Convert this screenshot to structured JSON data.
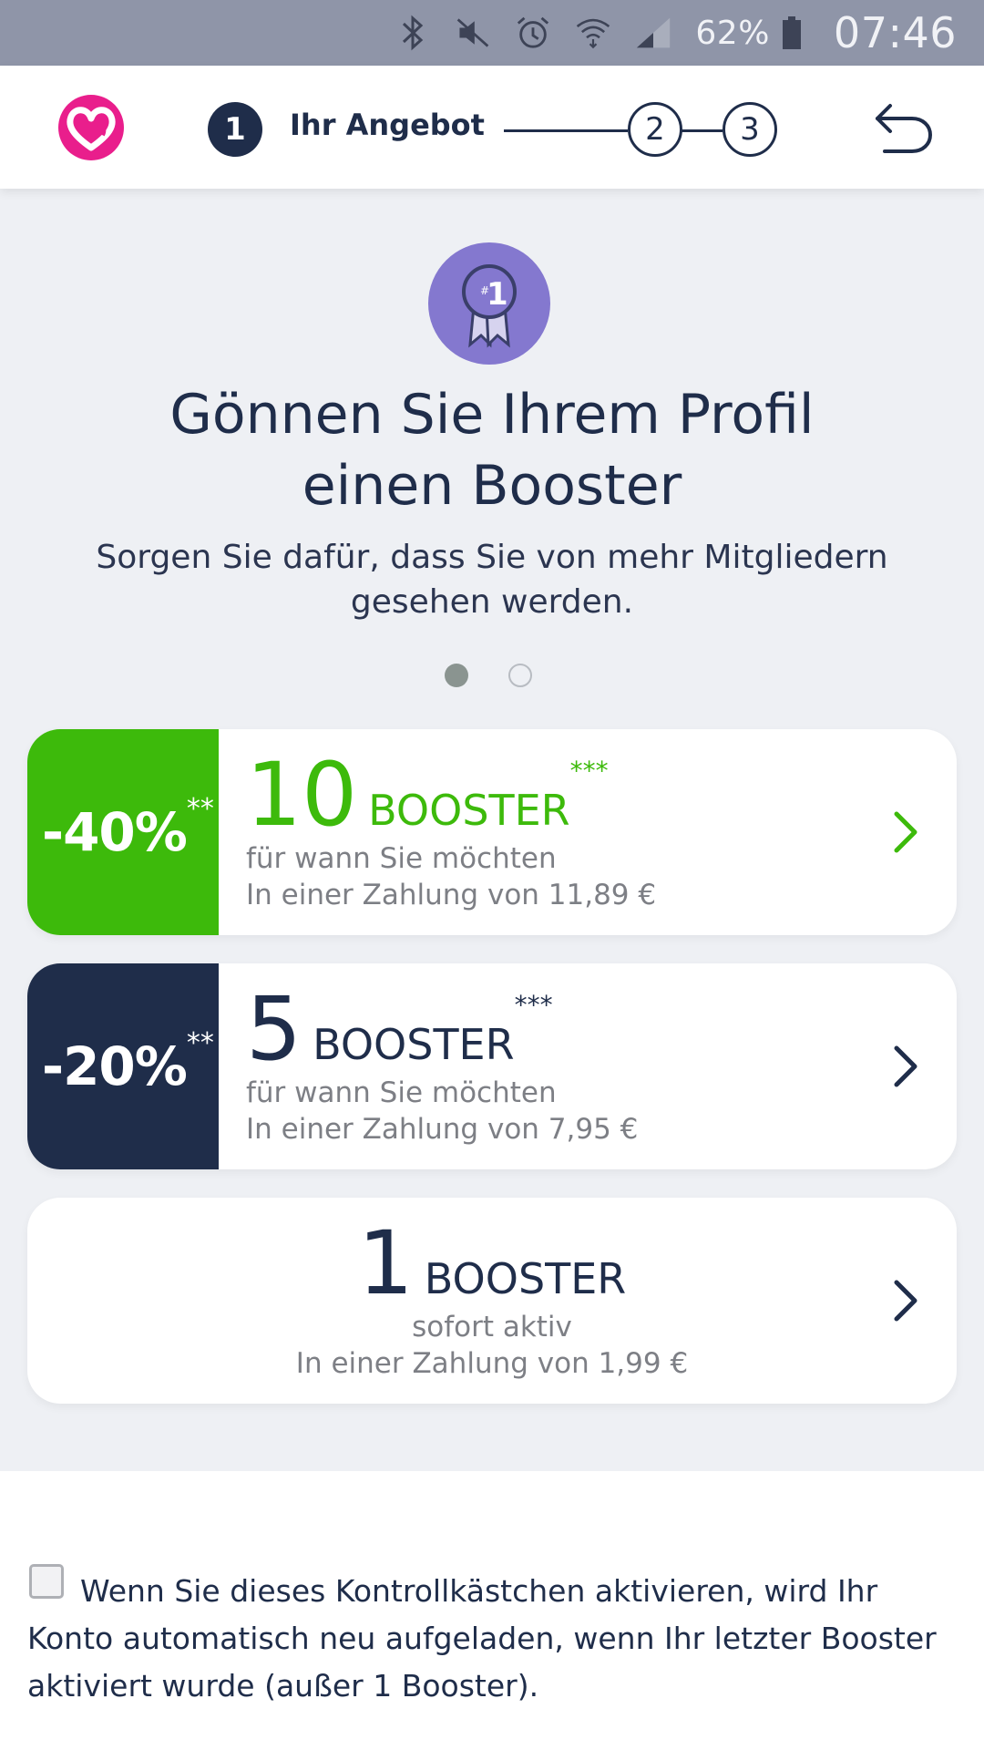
{
  "status_bar": {
    "icons": [
      "bluetooth-icon",
      "mute-icon",
      "alarm-icon",
      "wifi-icon",
      "cell-signal-icon",
      "battery-icon"
    ],
    "battery": "62%",
    "time": "07:46",
    "bg_color": "#8f95a8"
  },
  "header": {
    "current_step": "1",
    "current_step_label": "Ihr Angebot",
    "steps": [
      "2",
      "3"
    ],
    "logo_color": "#e91e8c"
  },
  "hero": {
    "badge_text": "1",
    "badge_prefix": "#",
    "title_line1": "Gönnen Sie Ihrem Profil",
    "title_line2": "einen Booster",
    "subtitle": "Sorgen Sie dafür, dass Sie von mehr Mitgliedern gesehen werden.",
    "badge_color": "#8478cf"
  },
  "pager": {
    "active_index": 0,
    "count": 2
  },
  "offers": [
    {
      "discount": "-40%",
      "discount_stars": "**",
      "qty": "10",
      "unit": "BOOSTER",
      "unit_stars": "***",
      "line1": "für wann Sie möchten",
      "line2": "In einer Zahlung von 11,89 €",
      "accent": "#3dba0b"
    },
    {
      "discount": "-20%",
      "discount_stars": "**",
      "qty": "5",
      "unit": "BOOSTER",
      "unit_stars": "***",
      "line1": "für wann Sie möchten",
      "line2": "In einer Zahlung von 7,95 €",
      "accent": "#1f2d4a"
    },
    {
      "qty": "1",
      "unit": "BOOSTER",
      "line1": "sofort aktiv",
      "line2": "In einer Zahlung von 1,99 €",
      "accent": "#1f2d4a"
    }
  ],
  "auto_renew": {
    "checked": false,
    "text": "Wenn Sie dieses Kontrollkästchen aktivieren, wird Ihr Konto automatisch neu aufgeladen, wenn Ihr letzter Booster aktiviert wurde (außer 1 Booster)."
  }
}
